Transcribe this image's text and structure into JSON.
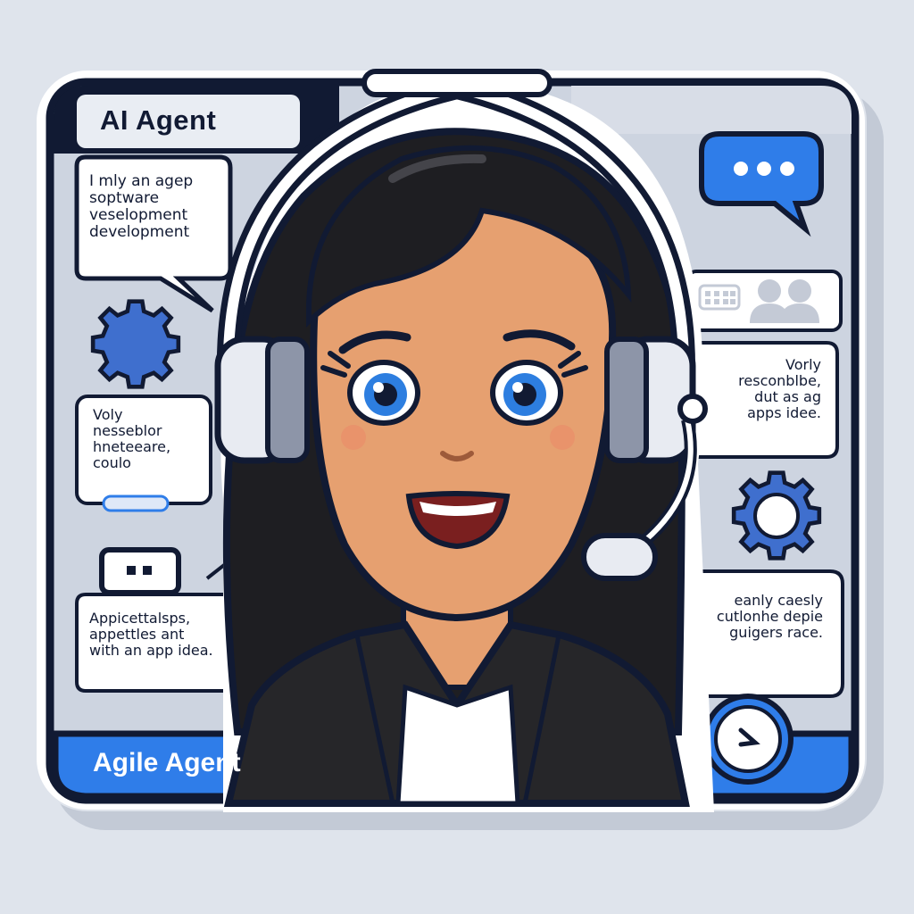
{
  "app": {
    "title": "AI Agent",
    "footer_label": "Agile Agent"
  },
  "bubbles": {
    "top_left": "I mly an agep\nsoptware\nveselopment\ndevelopment",
    "mid_left": "Voly\nnesseblor\nhneteeare,\ncoulo",
    "bottom_left": "Appicettalsps,\nappettles ant\nwith an app idea.",
    "mid_right": "Vorly\nresconblbe,\ndut as ag\napps idee.",
    "bottom_right": "eanly caesly\ncutlonhe depie\nguigers race."
  },
  "icons": {
    "chat": "chat-bubble-icon",
    "gear_left": "gear-icon",
    "gear_right": "gear-icon",
    "keyboard": "keyboard-icon",
    "people": "people-icon",
    "dots_box": "dots-icon",
    "next": "next-arrow-icon",
    "headset": "headset-icon"
  },
  "colors": {
    "frame_outline": "#111a33",
    "panel_bg": "#cdd4e0",
    "accent_blue": "#2f7de9",
    "bubble_bg": "#ffffff",
    "skin": "#e6a070",
    "hair": "#1e1e22",
    "eye_blue": "#2d7ee0",
    "jacket": "#262629"
  }
}
